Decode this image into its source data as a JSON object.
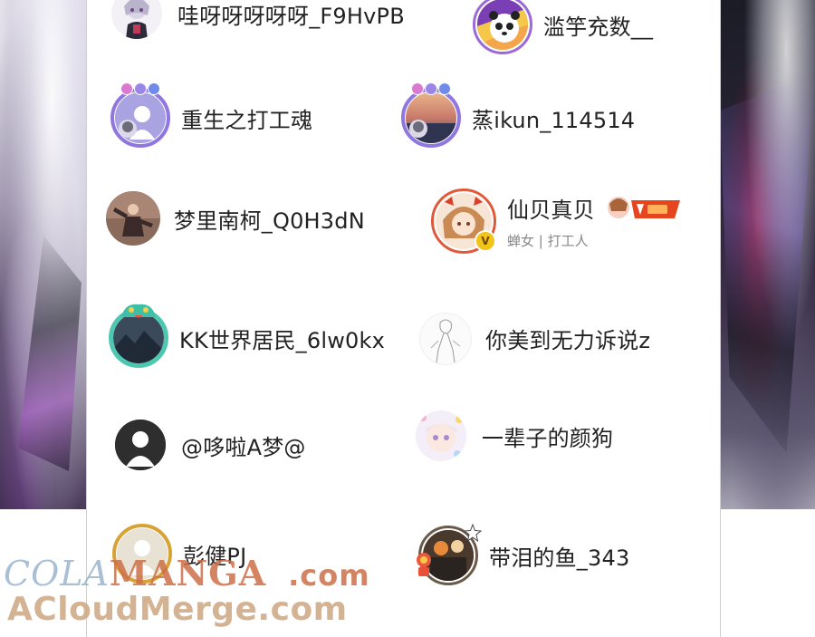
{
  "users": [
    {
      "id": "u1",
      "name": "哇呀呀呀呀呀_F9HvPB",
      "avatar_icon": "anime-girl-avatar-icon"
    },
    {
      "id": "u2",
      "name": "滥竽充数__",
      "avatar_icon": "panda-party-avatar-icon"
    },
    {
      "id": "u3",
      "name": "重生之打工魂",
      "avatar_icon": "default-avatar-framed-icon"
    },
    {
      "id": "u4",
      "name": "蒸ikun_114514",
      "avatar_icon": "sunset-framed-avatar-icon"
    },
    {
      "id": "u5",
      "name": "梦里南柯_Q0H3dN",
      "avatar_icon": "dancer-avatar-icon"
    },
    {
      "id": "u6",
      "name": "仙贝真贝",
      "subtitle": "蝉女 | 打工人",
      "verified": "V",
      "avatar_icon": "anime-girl-verified-avatar-icon",
      "badge_icon": "level-badge-icon"
    },
    {
      "id": "u7",
      "name": "KK世界居民_6lw0kx",
      "avatar_icon": "dragon-framed-avatar-icon"
    },
    {
      "id": "u8",
      "name": "你美到无力诉说z",
      "avatar_icon": "sketch-avatar-icon"
    },
    {
      "id": "u9",
      "name": "@哆啦A梦@",
      "avatar_icon": "default-avatar-icon"
    },
    {
      "id": "u10",
      "name": "一辈子的颜狗",
      "avatar_icon": "chibi-avatar-icon"
    },
    {
      "id": "u11",
      "name": "彭健PJ",
      "avatar_icon": "default-avatar-gold-frame-icon"
    },
    {
      "id": "u12",
      "name": "带泪的鱼_343",
      "avatar_icon": "halloween-avatar-icon"
    }
  ],
  "watermark": {
    "line1_part1": "COLA",
    "line1_part2": "MANGA",
    "line1_part3": ".com",
    "line2": "ACloudMerge.com"
  },
  "colors": {
    "name_text": "#222222",
    "subtitle_text": "#888888",
    "verified_badge": "#f2c318"
  }
}
